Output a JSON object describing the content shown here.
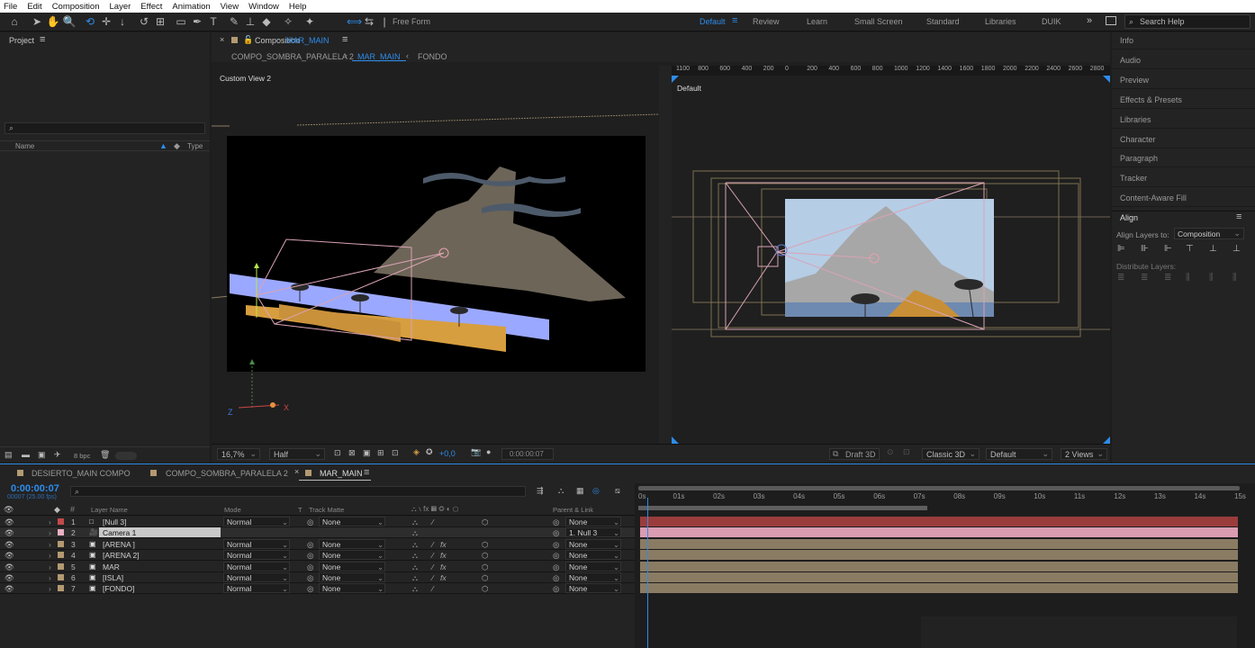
{
  "menu": [
    "File",
    "Edit",
    "Composition",
    "Layer",
    "Effect",
    "Animation",
    "View",
    "Window",
    "Help"
  ],
  "toolbar": {
    "mode_label": "Free Form"
  },
  "workspaces": {
    "default": "Default",
    "items": [
      "Review",
      "Learn",
      "Small Screen",
      "Standard",
      "Libraries",
      "DUIK"
    ],
    "search_placeholder": "Search Help"
  },
  "project": {
    "title": "Project",
    "col_name": "Name",
    "col_type": "Type",
    "bpc": "8 bpc"
  },
  "comp": {
    "title": "Composition",
    "name": "MAR_MAIN",
    "breadcrumbs": [
      "COMPO_SOMBRA_PARALELA 2",
      "MAR_MAIN",
      "FONDO"
    ],
    "view_left": "Custom View 2",
    "view_right": "Default"
  },
  "ruler": [
    "1100",
    "800",
    "600",
    "400",
    "200",
    "0",
    "200",
    "400",
    "600",
    "800",
    "1000",
    "1200",
    "1400",
    "1600",
    "1800",
    "2000",
    "2200",
    "2400",
    "2600",
    "2800"
  ],
  "viewer_bar": {
    "zoom": "16,7%",
    "resolution": "Half",
    "exposure": "+0,0",
    "timecode": "0:00:00:07",
    "draft": "Draft 3D",
    "renderer": "Classic 3D",
    "view": "Default",
    "views": "2 Views"
  },
  "right_panels": [
    "Info",
    "Audio",
    "Preview",
    "Effects & Presets",
    "Libraries",
    "Character",
    "Paragraph",
    "Tracker",
    "Content-Aware Fill"
  ],
  "align": {
    "title": "Align",
    "align_to_label": "Align Layers to:",
    "align_to_value": "Composition",
    "distribute_label": "Distribute Layers:"
  },
  "timeline_tabs": [
    {
      "name": "DESIERTO_MAIN COMPO",
      "color": "#b39a72"
    },
    {
      "name": "COMPO_SOMBRA_PARALELA 2",
      "color": "#b39a72"
    },
    {
      "name": "MAR_MAIN",
      "color": "#b39a72"
    }
  ],
  "timeline": {
    "timecode": "0:00:00:07",
    "fps": "00007 (25.00 fps)",
    "col_layer_name": "Layer Name",
    "col_mode": "Mode",
    "col_t": "T",
    "col_track_matte": "Track Matte",
    "col_parent": "Parent & Link",
    "ruler": [
      "0s",
      "01s",
      "02s",
      "03s",
      "04s",
      "05s",
      "06s",
      "07s",
      "08s",
      "09s",
      "10s",
      "11s",
      "12s",
      "13s",
      "14s",
      "15s"
    ],
    "current_fraction": 0.015,
    "work_area_end_fraction": 0.48
  },
  "layers": [
    {
      "num": "1",
      "name": "[Null 3]",
      "color": "#c24a4a",
      "icon": "null-layer-icon",
      "mode": "Normal",
      "matte": "None",
      "parent": "None",
      "bar": "#9b3c3c",
      "fx": false
    },
    {
      "num": "2",
      "name": "Camera 1",
      "color": "#e8b0c2",
      "icon": "camera-icon",
      "mode": "",
      "matte": "",
      "parent": "1. Null 3",
      "bar": "#d99cb1",
      "fx": false,
      "selected": true
    },
    {
      "num": "3",
      "name": "[ARENA ]",
      "color": "#b39a72",
      "icon": "comp-icon",
      "mode": "Normal",
      "matte": "None",
      "parent": "None",
      "bar": "#8a7b63",
      "fx": true
    },
    {
      "num": "4",
      "name": "[ARENA 2]",
      "color": "#b39a72",
      "icon": "comp-icon",
      "mode": "Normal",
      "matte": "None",
      "parent": "None",
      "bar": "#8a7b63",
      "fx": true
    },
    {
      "num": "5",
      "name": "MAR",
      "color": "#b39a72",
      "icon": "comp-icon",
      "mode": "Normal",
      "matte": "None",
      "parent": "None",
      "bar": "#8a7b63",
      "fx": true
    },
    {
      "num": "6",
      "name": "[ISLA]",
      "color": "#b39a72",
      "icon": "comp-icon",
      "mode": "Normal",
      "matte": "None",
      "parent": "None",
      "bar": "#8a7b63",
      "fx": true
    },
    {
      "num": "7",
      "name": "[FONDO]",
      "color": "#b39a72",
      "icon": "comp-icon",
      "mode": "Normal",
      "matte": "None",
      "parent": "None",
      "bar": "#8a7b63",
      "fx": false
    }
  ],
  "colors": {
    "accent": "#2d8ceb",
    "panel": "#232323",
    "viewer": "#1f1f1f"
  }
}
